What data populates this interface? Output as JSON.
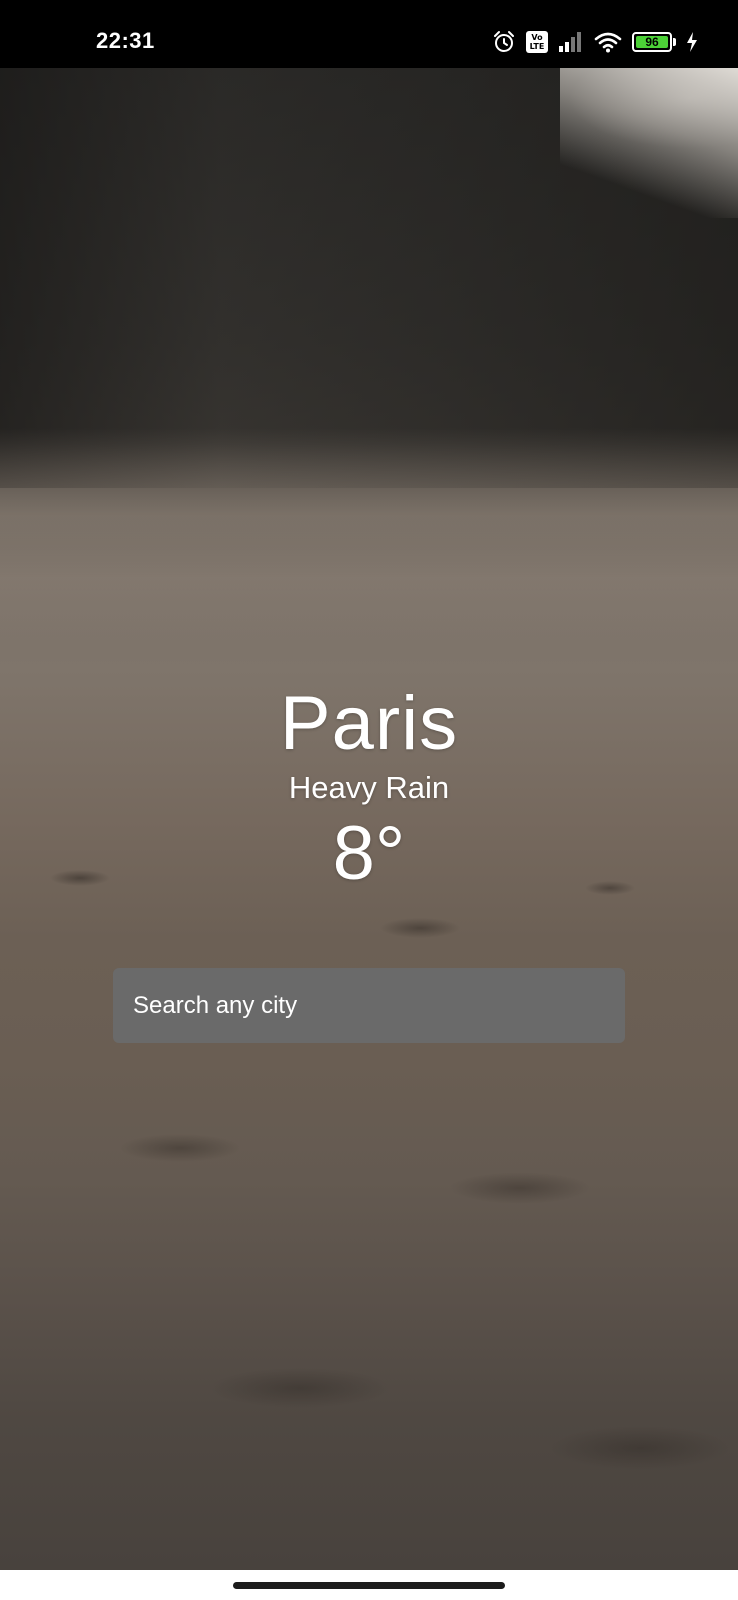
{
  "status_bar": {
    "time": "22:31",
    "battery_level": "96",
    "icons": [
      "alarm-icon",
      "volte-icon",
      "signal-icon",
      "wifi-icon",
      "battery-icon",
      "charging-icon"
    ],
    "volte_text": "Vo\nLTE"
  },
  "weather": {
    "city": "Paris",
    "condition": "Heavy Rain",
    "temperature": "8°"
  },
  "search": {
    "placeholder": "Search any city",
    "value": ""
  },
  "colors": {
    "text": "#ffffff",
    "search_bg": "#6a6a6a",
    "battery_fill": "#4cd137",
    "status_bar_bg": "#000000"
  }
}
